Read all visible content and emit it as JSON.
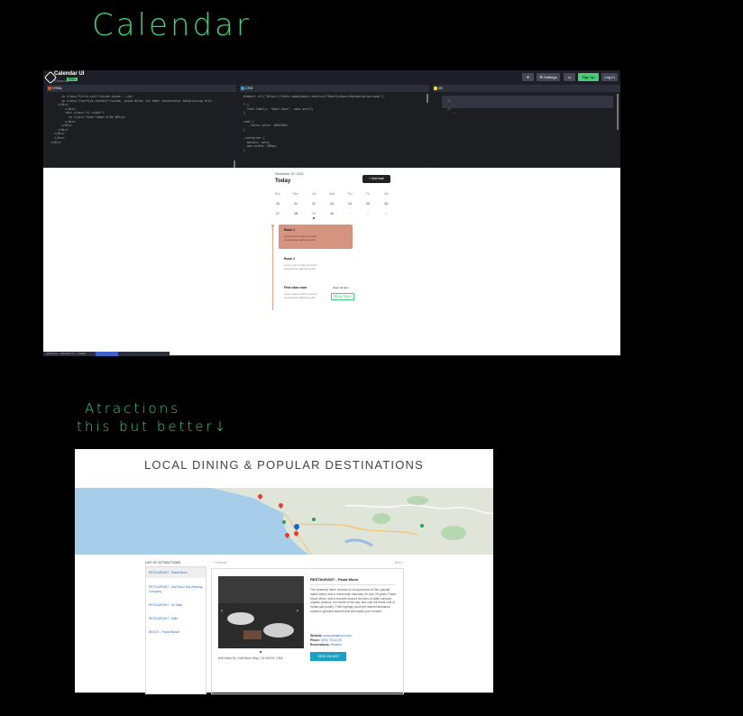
{
  "annotations": {
    "calendar": "Calendar",
    "attractions_line1": "Atractions",
    "attractions_line2": "this but better↓"
  },
  "codepen": {
    "title": "Calendar UI",
    "user": "Ebotomo",
    "pro": "PRO",
    "buttons": {
      "heart": "♥",
      "settings": "⚙ Settings",
      "layout": "▭",
      "signup": "Sign Up",
      "login": "Log In"
    },
    "panes": {
      "html": "HTML",
      "css": "CSS",
      "js": "JS"
    },
    "html_code": "      <p class=\"title-cntr\">Lorem ipsum...</p>\n      <p class=\"fourfive-content\">Lorem, ipsum dolor sit amet consectetur adipisicing elit...\n    </div>\n        </div>\n        <div class=\"cl-right\">\n          <p class=\"time\">Open 8:00 AM</p>\n        </div>\n      </div>\n    </div>\n  </div>\n  </div>\n</div>",
    "css_code": "@import url(\"https://fonts.googleapis.com/css2?family=Open+Sans&display=swap\");\n\n* {\n  font-family: \"Open Sans\", sans-serif;\n}\n\nroot {\n  --focus-color: #6d7d8d;\n}\n\n.container {\n  margin: auto;\n  max-width: 366px;\n}",
    "js_code": "\n  //\n    ...\n  //\n    ...",
    "footer": "Ebotomo · Calendar UI · 1 Editor"
  },
  "calendar_ui": {
    "date": "November 20, 2022",
    "heading": "Today",
    "add_task": "+ Add task",
    "day_names": [
      "Sun",
      "Mon",
      "Tue",
      "Wed",
      "Thu",
      "Fri",
      "Sat"
    ],
    "week1": [
      "20",
      "21",
      "22",
      "23",
      "24",
      "25",
      "26"
    ],
    "week2": [
      "27",
      "28",
      "29",
      "30",
      "1",
      "2",
      "3"
    ],
    "events": [
      {
        "title": "Room 1",
        "text": "Lorem ipsum dolor sit amet consectetur adipiscing elit"
      },
      {
        "title": "Room 2",
        "text": "Lorem ipsum dolor sit amet consectetur adipiscing elit"
      },
      {
        "title": "First class room",
        "text": "Lorem ipsum dolor sit amet consectetur adipiscing elit",
        "time": "Open till 3pm"
      }
    ],
    "hand_note": "Blog Now"
  },
  "dining": {
    "title": "LOCAL DINING & POPULAR DESTINATIONS",
    "list_heading": "LIST OF ATTRACTIONS",
    "prev": "« Previous",
    "next": "Next »",
    "items": [
      "RESTAURANT - Pasta Moon",
      "RESTAURANT - Half Moon Bay Brewing Company",
      "RESTAURANT - It's Italia",
      "RESTAURANT - Main",
      "BEACH - Poplar Beach"
    ],
    "detail": {
      "title": "RESTAURANT - Pasta Moon",
      "text": "The seasonal menu focuses on local produce at this upscale Italian eatery and a community mainstay for over 25 years. Pasta Moon Menu, which revolves around the farm-to-table concept organic produce, the whole of the day, and only the finest cuts of meats and poultry. Their stylingly sunlit yet relaxed ambiance evokes a genuine warmth that will inspire your senses.",
      "website_label": "Website:",
      "website": "www.pastamoon.com",
      "phone_label": "Phone:",
      "phone": "(650) 726-5125",
      "reservations_label": "Reservations:",
      "reservations": "Reserve",
      "view_map": "VIEW ON MAP",
      "address": "845 Main St, Half Moon Bay, CA 94019, USA"
    }
  },
  "colors": {
    "accent_green": "#3fcf7a",
    "card": "#d49480",
    "link": "#3a6fc0",
    "map_button": "#17a2c6"
  }
}
